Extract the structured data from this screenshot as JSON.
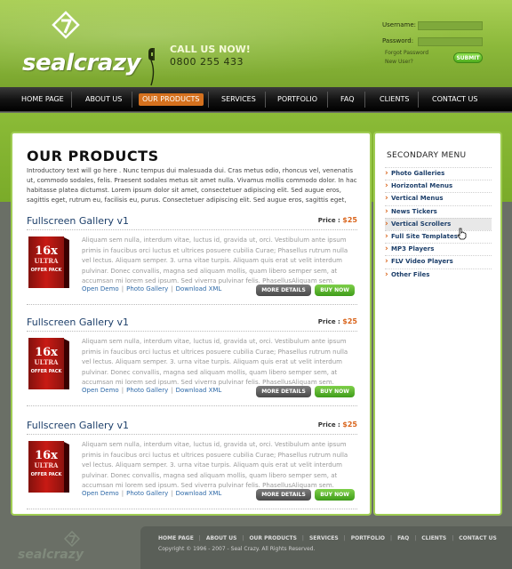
{
  "header": {
    "logo": "sealcrazy",
    "call_label": "CALL US NOW!",
    "call_number": "0800 255 433",
    "login": {
      "username_label": "Username:",
      "password_label": "Password:",
      "forgot": "Forgot Password",
      "new_user": "New User?",
      "submit": "SUBMIT"
    }
  },
  "nav": {
    "items": [
      {
        "label": "HOME PAGE"
      },
      {
        "label": "ABOUT US"
      },
      {
        "label": "OUR PRODUCTS"
      },
      {
        "label": "SERVICES"
      },
      {
        "label": "PORTFOLIO"
      },
      {
        "label": "FAQ"
      },
      {
        "label": "CLIENTS"
      },
      {
        "label": "CONTACT US"
      }
    ],
    "active_index": 2
  },
  "main": {
    "title": "OUR PRODUCTS",
    "intro": "Introductory text will go here . Nunc tempus dui malesuada dui. Cras metus odio, rhoncus vel, venenatis ut, commodo sodales, felis. Praesent sodales metus sit amet nulla. Vivamus mollis commodo dolor. In hac habitasse platea dictumst. Lorem ipsum dolor sit amet, consectetuer adipiscing elit. Sed augue eros, sagittis eget, rutrum eu, facilisis eu, purus. Consectetuer adipiscing elit. Sed augue eros, sagittis eget,",
    "products": [
      {
        "title": "Fullscreen Gallery v1",
        "price_label": "Price :",
        "price": "$25",
        "description": "Aliquam sem nulla, interdum vitae, luctus id, gravida ut, orci. Vestibulum ante ipsum primis in faucibus orci luctus et ultrices posuere cubilia Curae; Phasellus rutrum nulla vel lectus. Aliquam semper. 3. urna vitae turpis. Aliquam quis erat ut velit interdum pulvinar. Donec convallis, magna sed aliquam mollis, quam libero semper sem, at accumsan mi lorem sed ipsum. Sed viverra pulvinar felis. PhasellusAliquam sem.",
        "link_demo": "Open Demo",
        "link_gallery": "Photo Gallery",
        "link_xml": "Download XML",
        "more": "MORE DETAILS",
        "buy": "BUY NOW"
      },
      {
        "title": "Fullscreen Gallery v1",
        "price_label": "Price :",
        "price": "$25",
        "description": "Aliquam sem nulla, interdum vitae, luctus id, gravida ut, orci. Vestibulum ante ipsum primis in faucibus orci luctus et ultrices posuere cubilia Curae; Phasellus rutrum nulla vel lectus. Aliquam semper. 3. urna vitae turpis. Aliquam quis erat ut velit interdum pulvinar. Donec convallis, magna sed aliquam mollis, quam libero semper sem, at accumsan mi lorem sed ipsum. Sed viverra pulvinar felis. PhasellusAliquam sem.",
        "link_demo": "Open Demo",
        "link_gallery": "Photo Gallery",
        "link_xml": "Download XML",
        "more": "MORE DETAILS",
        "buy": "BUY NOW"
      },
      {
        "title": "Fullscreen Gallery v1",
        "price_label": "Price :",
        "price": "$25",
        "description": "Aliquam sem nulla, interdum vitae, luctus id, gravida ut, orci. Vestibulum ante ipsum primis in faucibus orci luctus et ultrices posuere cubilia Curae; Phasellus rutrum nulla vel lectus. Aliquam semper. 3. urna vitae turpis. Aliquam quis erat ut velit interdum pulvinar. Donec convallis, magna sed aliquam mollis, quam libero semper sem, at accumsan mi lorem sed ipsum. Sed viverra pulvinar felis. PhasellusAliquam sem.",
        "link_demo": "Open Demo",
        "link_gallery": "Photo Gallery",
        "link_xml": "Download XML",
        "more": "MORE DETAILS",
        "buy": "BUY NOW"
      }
    ],
    "box_art": {
      "line1": "16x",
      "line2": "ULTRA",
      "line3": "OFFER PACK"
    }
  },
  "sidebar": {
    "title": "SECONDARY MENU",
    "items": [
      {
        "label": "Photo Galleries"
      },
      {
        "label": "Horizontal Menus"
      },
      {
        "label": "Vertical Menus"
      },
      {
        "label": "News Tickers"
      },
      {
        "label": "Vertical Scrollers"
      },
      {
        "label": "Full Site Templates"
      },
      {
        "label": "MP3 Players"
      },
      {
        "label": "FLV Video Players"
      },
      {
        "label": "Other Files"
      }
    ],
    "hover_index": 4
  },
  "footer": {
    "logo": "sealcrazy",
    "nav": [
      "HOME PAGE",
      "ABOUT US",
      "OUR PRODUCTS",
      "SERVICES",
      "PORTFOLIO",
      "FAQ",
      "CLIENTS",
      "CONTACT US"
    ],
    "copyright": "Copyright ©  1996 - 2007 - Seal Crazy.  All Rights Reserved."
  },
  "colors": {
    "brand_green": "#8bb83a",
    "accent_orange": "#d5711e",
    "link_blue": "#2f6aa8",
    "title_blue": "#1d3f6a"
  }
}
